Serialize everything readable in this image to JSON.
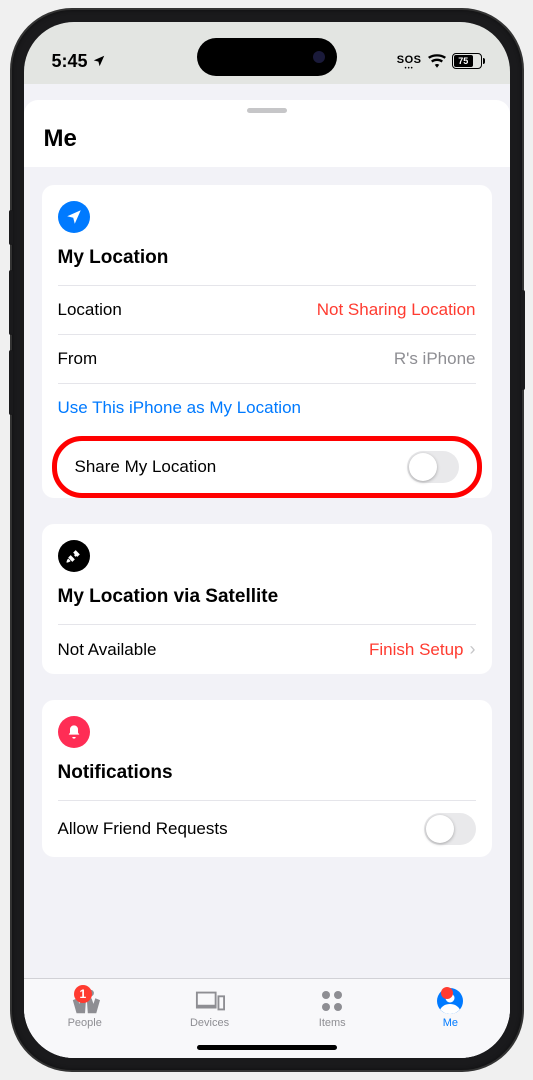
{
  "status": {
    "time": "5:45",
    "sos": "SOS",
    "battery_pct": "75"
  },
  "sheet": {
    "title": "Me"
  },
  "location_card": {
    "heading": "My Location",
    "rows": {
      "location_label": "Location",
      "location_value": "Not Sharing Location",
      "from_label": "From",
      "from_value": "R's iPhone"
    },
    "link": "Use This iPhone as My Location",
    "share_label": "Share My Location"
  },
  "satellite_card": {
    "heading": "My Location via Satellite",
    "status_label": "Not Available",
    "action_label": "Finish Setup"
  },
  "notifications_card": {
    "heading": "Notifications",
    "allow_label": "Allow Friend Requests"
  },
  "tabs": {
    "people": "People",
    "devices": "Devices",
    "items": "Items",
    "me": "Me",
    "people_badge": "1"
  }
}
